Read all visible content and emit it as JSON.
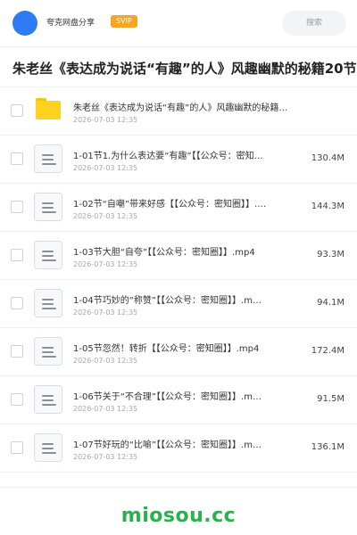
{
  "header": {
    "brand": "夸克网盘分享",
    "badge": "SVIP",
    "search_placeholder": "搜索"
  },
  "title": "朱老丝《表达成为说话“有趣”的人》风趣幽默的秘籍20节",
  "files": [
    {
      "type": "folder",
      "name": "朱老丝《表达成为说话“有趣”的人》风趣幽默的秘籍2…",
      "date": "2026-07-03 12:35",
      "size": ""
    },
    {
      "type": "file",
      "name": "1-01节1.为什么表达要“有趣”【【公众号：密知…",
      "date": "2026-07-03 12:35",
      "size": "130.4M"
    },
    {
      "type": "file",
      "name": "1-02节“自嘲”带来好感【【公众号：密知圈】】.…",
      "date": "2026-07-03 12:35",
      "size": "144.3M"
    },
    {
      "type": "file",
      "name": "1-03节大胆“自夸”【【公众号：密知圈】】.mp4",
      "date": "2026-07-03 12:35",
      "size": "93.3M"
    },
    {
      "type": "file",
      "name": "1-04节巧妙的“称赞”【【公众号：密知圈】】.m…",
      "date": "2026-07-03 12:35",
      "size": "94.1M"
    },
    {
      "type": "file",
      "name": "1-05节忽然！转折【【公众号：密知圈】】.mp4",
      "date": "2026-07-03 12:35",
      "size": "172.4M"
    },
    {
      "type": "file",
      "name": "1-06节关于“不合理”【【公众号：密知圈】】.m…",
      "date": "2026-07-03 12:35",
      "size": "91.5M"
    },
    {
      "type": "file",
      "name": "1-07节好玩的“比喻”【【公众号：密知圈】】.m…",
      "date": "2026-07-03 12:35",
      "size": "136.1M"
    }
  ],
  "watermark": "miosou.cc",
  "colors": {
    "accent": "#2f7bf6",
    "badge": "#f5a623",
    "folder": "#ffd21f",
    "watermark": "#27b24a"
  }
}
